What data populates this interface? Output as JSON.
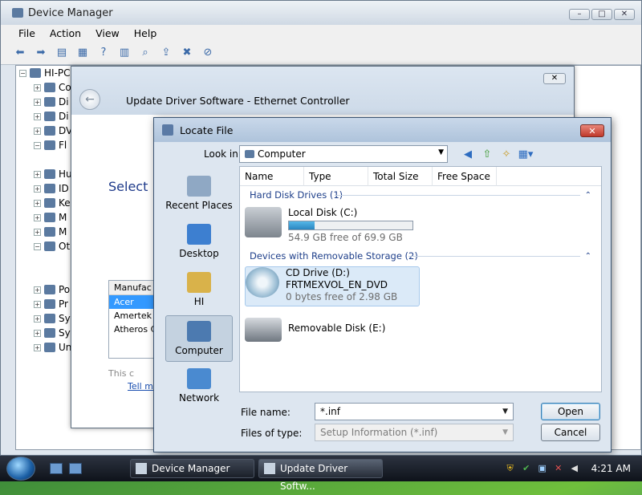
{
  "device_manager": {
    "title": "Device Manager",
    "menu": [
      "File",
      "Action",
      "View",
      "Help"
    ],
    "root": "HI-PC",
    "tree_labels": [
      "Co",
      "Di",
      "Di",
      "DV",
      "Fl",
      "Hu",
      "ID",
      "Ke",
      "M",
      "M",
      "Ot",
      "",
      "",
      "Po",
      "Pr",
      "Sy",
      "Sy",
      "Un"
    ]
  },
  "update_driver": {
    "title": "Update Driver Software - Ethernet Controller",
    "select_heading": "Select N",
    "list_header": "Manufac",
    "list_items": [
      "Acer",
      "Amertek",
      "Atheros C"
    ],
    "signed_text": "This c",
    "tell_link": "Tell m"
  },
  "locate_file": {
    "title": "Locate File",
    "look_in_label": "Look in:",
    "look_in_value": "Computer",
    "columns": [
      "Name",
      "Type",
      "Total Size",
      "Free Space"
    ],
    "places": [
      "Recent Places",
      "Desktop",
      "HI",
      "Computer",
      "Network"
    ],
    "groups": {
      "hdd": "Hard Disk Drives (1)",
      "removable": "Devices with Removable Storage (2)"
    },
    "items": {
      "local_disk": {
        "name": "Local Disk (C:)",
        "free": "54.9 GB free of 69.9 GB",
        "used_fraction": 0.21
      },
      "cd_drive": {
        "name": "CD Drive (D:)",
        "label": "FRTMEXVOL_EN_DVD",
        "free": "0 bytes free of 2.98 GB"
      },
      "removable": {
        "name": "Removable Disk (E:)"
      }
    },
    "file_name_label": "File name:",
    "file_name_value": "*.inf",
    "file_type_label": "Files of type:",
    "file_type_value": "Setup Information (*.inf)",
    "open_label": "Open",
    "cancel_label": "Cancel"
  },
  "taskbar": {
    "tasks": [
      "Device Manager",
      "Update Driver Softw..."
    ],
    "clock": "4:21 AM"
  }
}
